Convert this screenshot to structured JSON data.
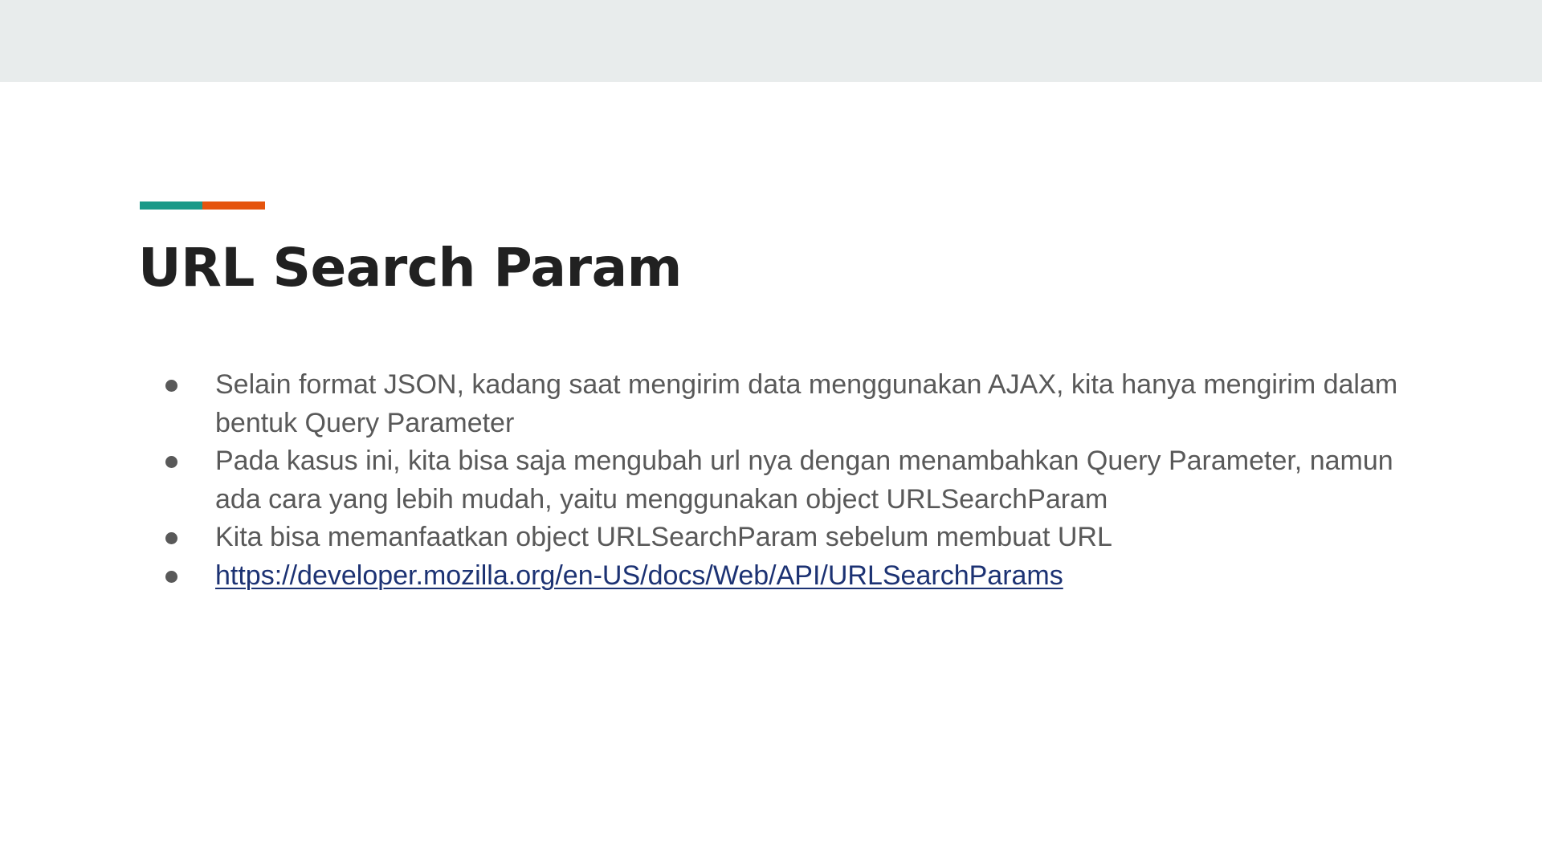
{
  "slide": {
    "title": "URL Search Param",
    "accent_colors": [
      "#1a9988",
      "#e5540d"
    ],
    "bullets": [
      {
        "text": "Selain format JSON, kadang saat mengirim data menggunakan AJAX, kita hanya mengirim dalam bentuk Query Parameter"
      },
      {
        "text": "Pada kasus ini, kita bisa saja mengubah url nya dengan menambahkan Query Parameter, namun ada cara yang lebih mudah, yaitu menggunakan object URLSearchParam"
      },
      {
        "text": "Kita bisa memanfaatkan object URLSearchParam sebelum membuat URL"
      },
      {
        "text": "https://developer.mozilla.org/en-US/docs/Web/API/URLSearchParams"
      }
    ]
  },
  "colors": {
    "top_band": "#e8ecec",
    "title": "#212121",
    "body_text": "#595959",
    "link": "#1c3273"
  }
}
